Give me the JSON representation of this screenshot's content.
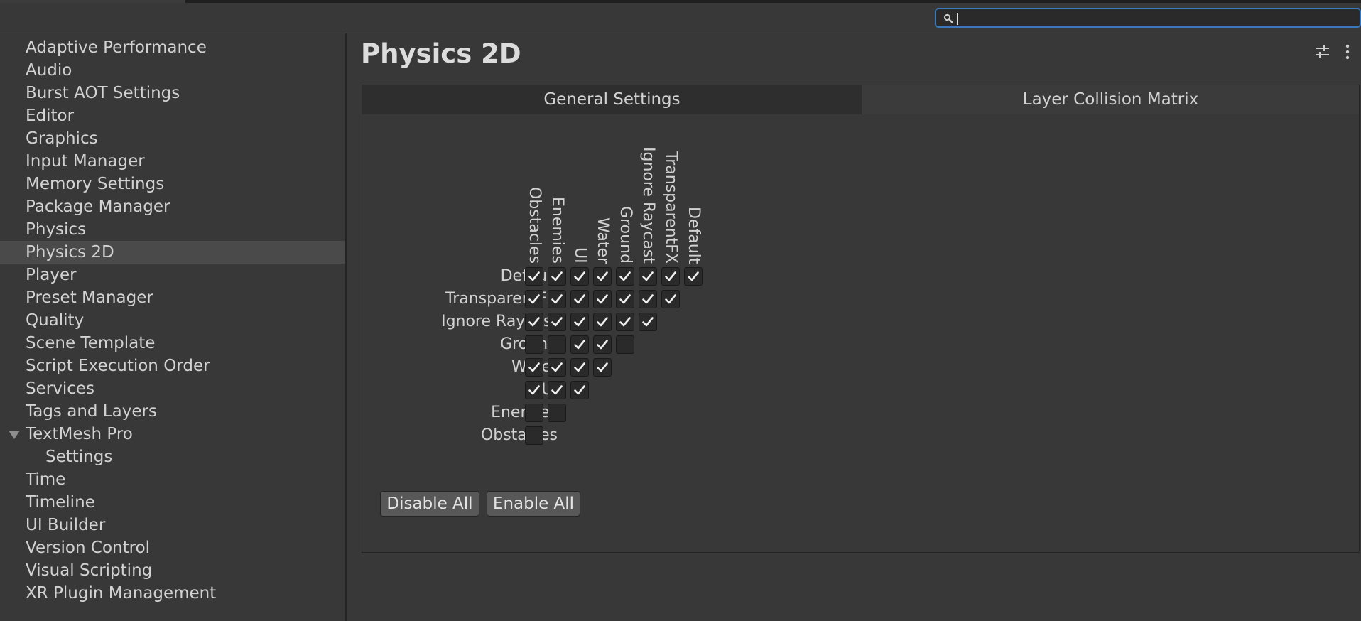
{
  "search": {
    "placeholder": ""
  },
  "sidebar": {
    "items": [
      {
        "label": "Adaptive Performance"
      },
      {
        "label": "Audio"
      },
      {
        "label": "Burst AOT Settings"
      },
      {
        "label": "Editor"
      },
      {
        "label": "Graphics"
      },
      {
        "label": "Input Manager"
      },
      {
        "label": "Memory Settings"
      },
      {
        "label": "Package Manager"
      },
      {
        "label": "Physics"
      },
      {
        "label": "Physics 2D",
        "selected": true
      },
      {
        "label": "Player"
      },
      {
        "label": "Preset Manager"
      },
      {
        "label": "Quality"
      },
      {
        "label": "Scene Template"
      },
      {
        "label": "Script Execution Order"
      },
      {
        "label": "Services"
      },
      {
        "label": "Tags and Layers"
      },
      {
        "label": "TextMesh Pro",
        "expanded": true
      },
      {
        "label": "Settings",
        "child": true
      },
      {
        "label": "Time"
      },
      {
        "label": "Timeline"
      },
      {
        "label": "UI Builder"
      },
      {
        "label": "Version Control"
      },
      {
        "label": "Visual Scripting"
      },
      {
        "label": "XR Plugin Management"
      }
    ]
  },
  "main": {
    "title": "Physics 2D",
    "tabs": [
      {
        "label": "General Settings",
        "active": false
      },
      {
        "label": "Layer Collision Matrix",
        "active": true
      }
    ],
    "matrix": {
      "columns": [
        "Obstacles",
        "Enemies",
        "UI",
        "Water",
        "Ground",
        "Ignore Raycast",
        "TransparentFX",
        "Default"
      ],
      "rows": [
        {
          "label": "Default",
          "values": [
            true,
            true,
            true,
            true,
            true,
            true,
            true,
            true
          ]
        },
        {
          "label": "TransparentFX",
          "values": [
            true,
            true,
            true,
            true,
            true,
            true,
            true
          ]
        },
        {
          "label": "Ignore Raycast",
          "values": [
            true,
            true,
            true,
            true,
            true,
            true
          ]
        },
        {
          "label": "Ground",
          "values": [
            false,
            false,
            true,
            true,
            false
          ]
        },
        {
          "label": "Water",
          "values": [
            true,
            true,
            true,
            true
          ]
        },
        {
          "label": "UI",
          "values": [
            true,
            true,
            true
          ]
        },
        {
          "label": "Enemies",
          "values": [
            false,
            false
          ]
        },
        {
          "label": "Obstacles",
          "values": [
            false
          ]
        }
      ]
    },
    "buttons": {
      "disable_all": "Disable All",
      "enable_all": "Enable All"
    }
  },
  "icons": {
    "search": "search-icon",
    "settings": "sliders-icon",
    "menu": "kebab-menu-icon"
  },
  "colors": {
    "accent": "#3a79bb",
    "background": "#383838",
    "selected": "#4a4a4a"
  }
}
